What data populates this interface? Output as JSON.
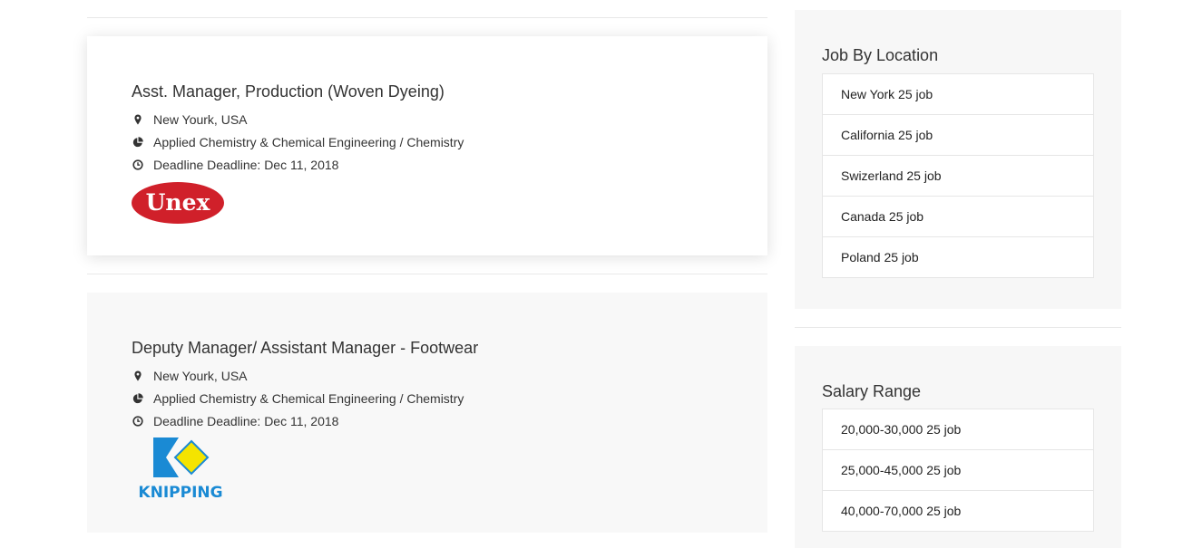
{
  "jobs": [
    {
      "title": "Asst. Manager, Production (Woven Dyeing)",
      "location": "New Yourk, USA",
      "category": "Applied Chemistry & Chemical Engineering / Chemistry",
      "deadline": "Deadline Deadline: Dec 11, 2018",
      "logo_text": "Unex",
      "logo_color": "#d0202a"
    },
    {
      "title": "Deputy Manager/ Assistant Manager - Footwear",
      "location": "New Yourk, USA",
      "category": "Applied Chemistry & Chemical Engineering / Chemistry",
      "deadline": "Deadline Deadline: Dec 11, 2018",
      "logo_text": "KNIPPING",
      "logo_color": "#1a8ad4",
      "logo_accent": "#f4e400"
    }
  ],
  "icons": {
    "location": "map-marker-icon",
    "category": "pie-chart-icon",
    "deadline": "clock-icon"
  },
  "sidebar": {
    "location": {
      "title": "Job By Location",
      "items": [
        "New York 25 job",
        "California 25 job",
        "Swizerland 25 job",
        "Canada 25 job",
        "Poland 25 job"
      ]
    },
    "salary": {
      "title": "Salary Range",
      "items": [
        "20,000-30,000 25 job",
        "25,000-45,000 25 job",
        "40,000-70,000 25 job"
      ]
    }
  }
}
